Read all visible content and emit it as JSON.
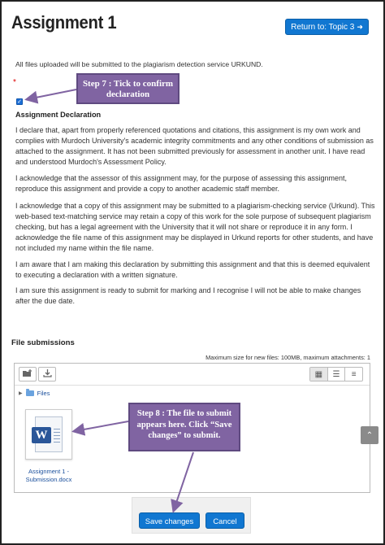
{
  "header": {
    "title": "Assignment 1",
    "return_button": "Return to: Topic 3",
    "return_icon": "sign-in-icon"
  },
  "notice": "All files uploaded will be submitted to the plagiarism detection service URKUND.",
  "required_marker": "*",
  "declaration": {
    "checked": true,
    "title": "Assignment Declaration",
    "paragraphs": [
      "I declare that, apart from properly referenced quotations and citations, this assignment is my own work and complies with Murdoch University's academic integrity commitments and any other conditions of submission as attached to the assignment. It has not been submitted previously for assessment in another unit. I have read and understood Murdoch's Assessment Policy.",
      "I acknowledge that the assessor of this assignment may, for the purpose of assessing this assignment, reproduce this assignment and provide a copy to another academic staff member.",
      "I acknowledge that a copy of this assignment may be submitted to a plagiarism-checking service (Urkund). This web-based text-matching service may retain a copy of this work for the sole purpose of subsequent plagiarism checking, but has a legal agreement with the University that it will not share or reproduce it in any form. I acknowledge the file name of this assignment may be displayed in Urkund reports for other students, and have not included my name within the file name.",
      "I am aware that I am making this declaration by submitting this assignment and that this is deemed equivalent to executing a declaration with a written signature.",
      "I am sure this assignment is ready to submit for marking and I recognise I will not be able to make changes after the due date."
    ]
  },
  "callouts": {
    "step7": "Step 7 :  Tick to confirm declaration",
    "step8": "Step 8 :  The file to submit appears here. Click “Save changes” to submit."
  },
  "file_submissions": {
    "title": "File submissions",
    "max_size": "Maximum size for new files: 100MB, maximum attachments: 1",
    "path_label": "Files",
    "file_name": "Assignment 1 - Submission.docx"
  },
  "buttons": {
    "save": "Save changes",
    "cancel": "Cancel"
  },
  "colors": {
    "primary_button": "#1177d1",
    "callout": "#8064a2",
    "link": "#1a4f9c"
  }
}
